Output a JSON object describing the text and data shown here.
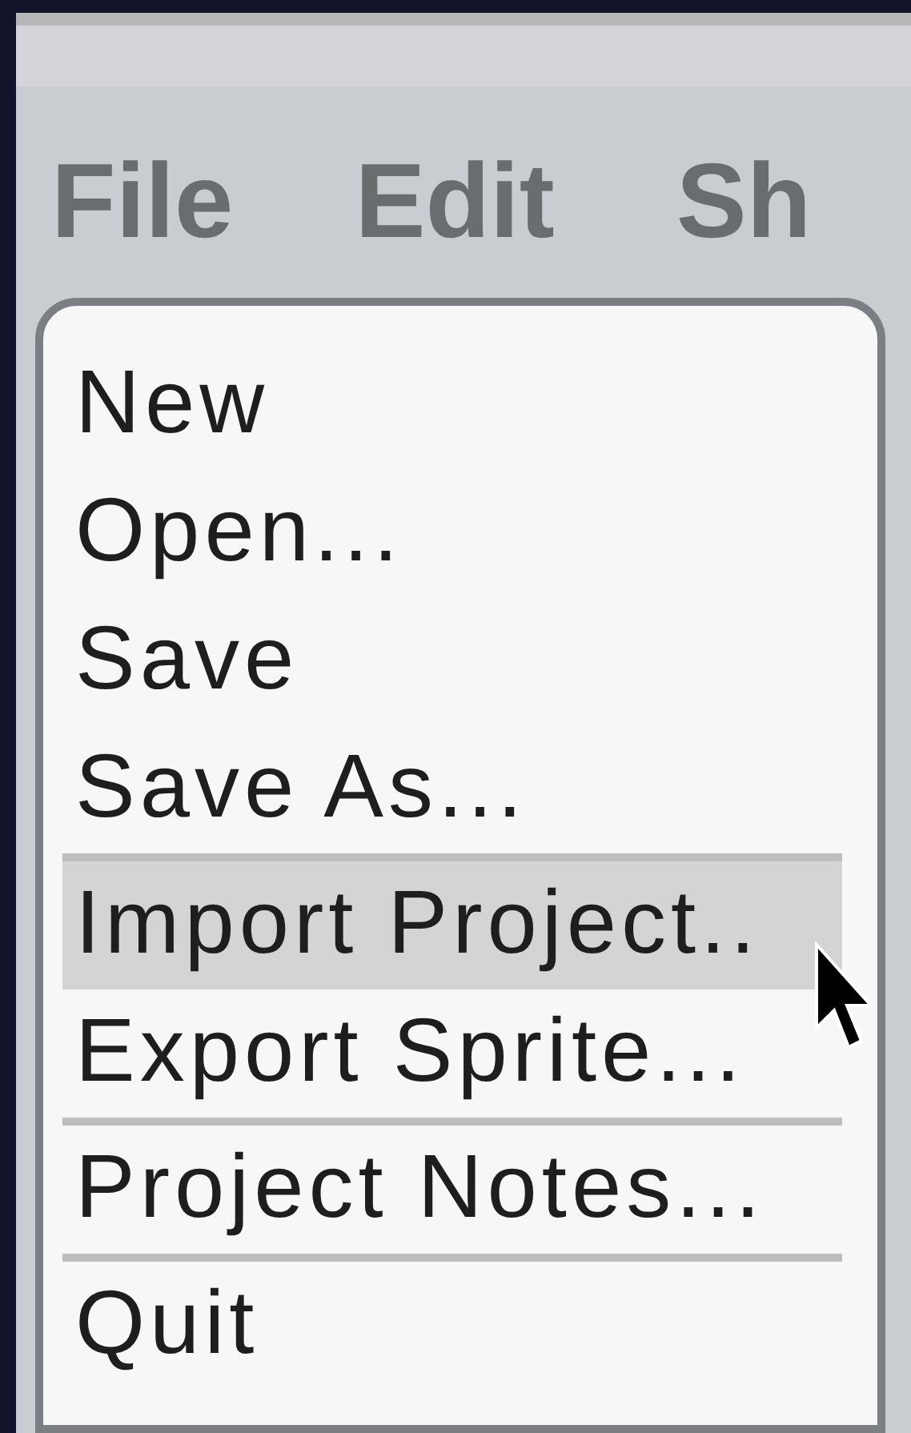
{
  "menu_bar": [
    {
      "label": "File"
    },
    {
      "label": "Edit"
    },
    {
      "label": "Sh"
    }
  ],
  "file_menu": [
    {
      "label": "New",
      "highlighted": false,
      "separator_before": false
    },
    {
      "label": "Open...",
      "highlighted": false,
      "separator_before": false
    },
    {
      "label": "Save",
      "highlighted": false,
      "separator_before": false
    },
    {
      "label": "Save As...",
      "highlighted": false,
      "separator_before": false
    },
    {
      "label": "Import Project..",
      "highlighted": true,
      "separator_before": true
    },
    {
      "label": "Export Sprite...",
      "highlighted": false,
      "separator_before": false
    },
    {
      "label": "Project Notes...",
      "highlighted": false,
      "separator_before": true
    },
    {
      "label": "Quit",
      "highlighted": false,
      "separator_before": true
    }
  ]
}
